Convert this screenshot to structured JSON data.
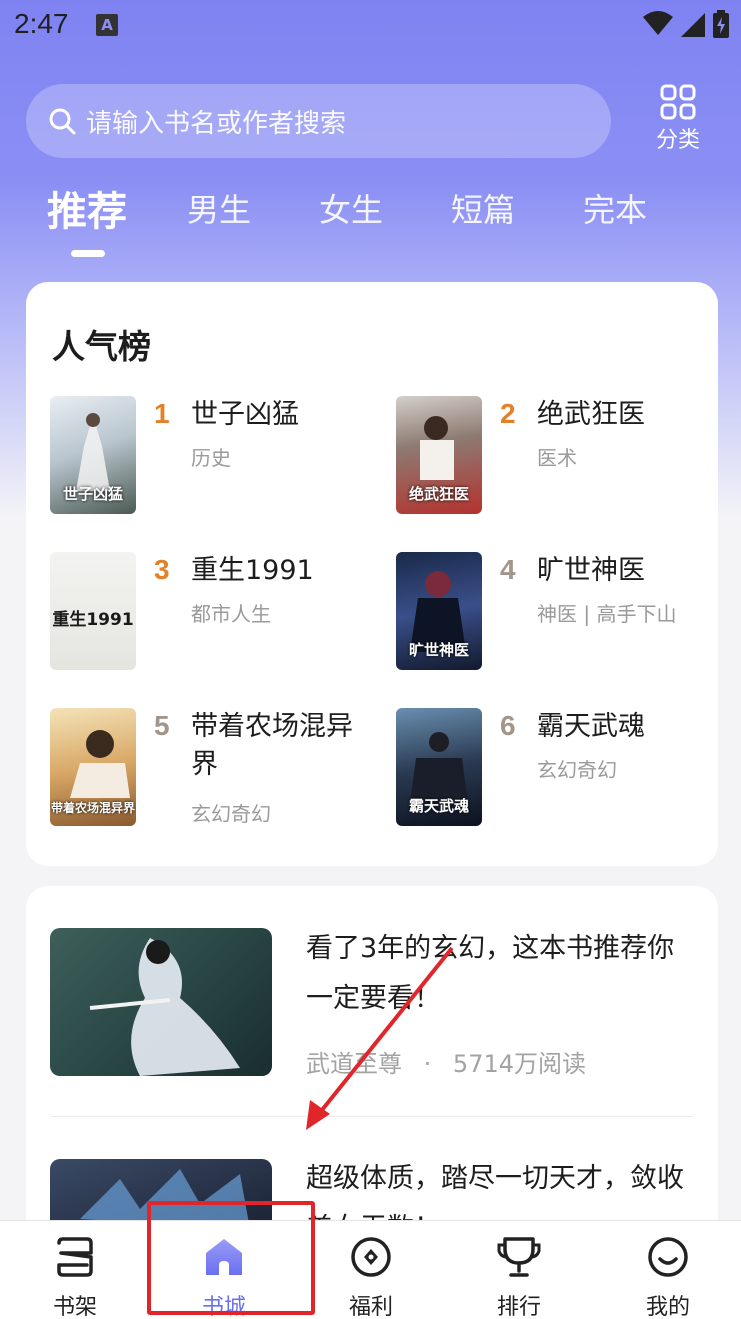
{
  "status_bar": {
    "time": "2:47",
    "notif_icon": "A"
  },
  "search": {
    "placeholder": "请输入书名或作者搜索"
  },
  "category_button": {
    "label": "分类",
    "icon": "grid-icon"
  },
  "tabs": [
    {
      "label": "推荐",
      "active": true
    },
    {
      "label": "男生",
      "active": false
    },
    {
      "label": "女生",
      "active": false
    },
    {
      "label": "短篇",
      "active": false
    },
    {
      "label": "完本",
      "active": false
    }
  ],
  "popular": {
    "title": "人气榜",
    "books": [
      {
        "rank": "1",
        "name": "世子凶猛",
        "tag": "历史",
        "cover_text": "世子凶猛",
        "rank_color": "#e3802a"
      },
      {
        "rank": "2",
        "name": "绝武狂医",
        "tag": "医术",
        "cover_text": "绝武狂医",
        "rank_color": "#e3802a"
      },
      {
        "rank": "3",
        "name": "重生1991",
        "tag": "都市人生",
        "cover_text": "重生1991",
        "rank_color": "#e3802a"
      },
      {
        "rank": "4",
        "name": "旷世神医",
        "tag": "神医 | 高手下山",
        "cover_text": "旷世神医",
        "rank_color": "#a3958a"
      },
      {
        "rank": "5",
        "name": "带着农场混异界",
        "tag": "玄幻奇幻",
        "cover_text": "带着农场混异界",
        "rank_color": "#a3958a"
      },
      {
        "rank": "6",
        "name": "霸天武魂",
        "tag": "玄幻奇幻",
        "cover_text": "霸天武魂",
        "rank_color": "#a3958a"
      }
    ]
  },
  "feed": [
    {
      "title": "看了3年的玄幻，这本书推荐你一定要看！",
      "book": "武道至尊",
      "dot": "·",
      "reads": "5714万阅读"
    },
    {
      "title": "超级体质，踏尽一切天才，敛收美女无数！",
      "book": "",
      "dot": "",
      "reads": ""
    }
  ],
  "bottom_nav": [
    {
      "label": "书架",
      "icon": "bookshelf-icon",
      "active": false
    },
    {
      "label": "书城",
      "icon": "home-icon",
      "active": true
    },
    {
      "label": "福利",
      "icon": "gift-coin-icon",
      "active": false
    },
    {
      "label": "排行",
      "icon": "trophy-icon",
      "active": false
    },
    {
      "label": "我的",
      "icon": "smiley-face-icon",
      "active": false
    }
  ],
  "colors": {
    "accent": "#6a6ff0",
    "rank_top": "#e3802a",
    "rank_other": "#a3958a",
    "highlight": "#e0262a"
  }
}
